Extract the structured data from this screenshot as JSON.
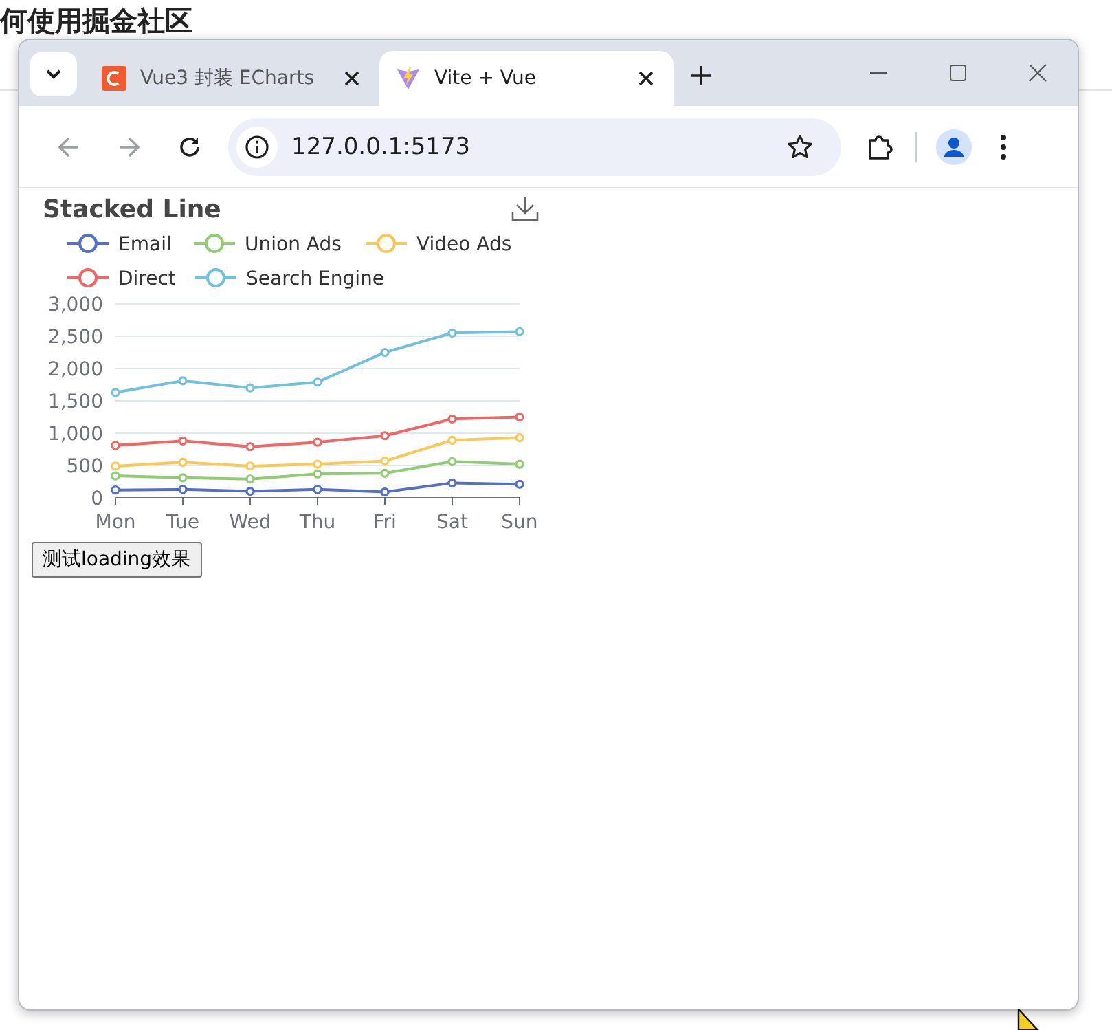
{
  "background_page": {
    "heading": "何使用掘金社区"
  },
  "window": {
    "tabs": [
      {
        "title": "Vue3 封装 ECharts",
        "selected": false,
        "kind": "csdn"
      },
      {
        "title": "Vite + Vue",
        "selected": true,
        "kind": "vite"
      }
    ],
    "address": "127.0.0.1:5173"
  },
  "content": {
    "chart_data": {
      "type": "line",
      "title": "Stacked Line",
      "grid": true,
      "legend": true,
      "categories": [
        "Mon",
        "Tue",
        "Wed",
        "Thu",
        "Fri",
        "Sat",
        "Sun"
      ],
      "ylim": [
        0,
        3000
      ],
      "yticks": [
        {
          "value": 0,
          "label": "0"
        },
        {
          "value": 500,
          "label": "500"
        },
        {
          "value": 1000,
          "label": "1,000"
        },
        {
          "value": 1500,
          "label": "1,500"
        },
        {
          "value": 2000,
          "label": "2,000"
        },
        {
          "value": 2500,
          "label": "2,500"
        },
        {
          "value": 3000,
          "label": "3,000"
        }
      ],
      "series": [
        {
          "name": "Email",
          "color": "#5470c6",
          "marker": "circle",
          "values": [
            120,
            130,
            100,
            130,
            90,
            230,
            210
          ]
        },
        {
          "name": "Union Ads",
          "color": "#91cc75",
          "marker": "circle",
          "values": [
            340,
            310,
            290,
            370,
            380,
            560,
            520
          ]
        },
        {
          "name": "Video Ads",
          "color": "#fac858",
          "marker": "circle",
          "values": [
            490,
            550,
            490,
            520,
            570,
            890,
            930
          ]
        },
        {
          "name": "Direct",
          "color": "#ee6666",
          "marker": "circle",
          "values": [
            810,
            880,
            790,
            860,
            960,
            1220,
            1250
          ]
        },
        {
          "name": "Search Engine",
          "color": "#73c0de",
          "marker": "circle",
          "values": [
            1630,
            1810,
            1700,
            1790,
            2250,
            2550,
            2570
          ]
        }
      ]
    },
    "button": "测试loading效果"
  }
}
